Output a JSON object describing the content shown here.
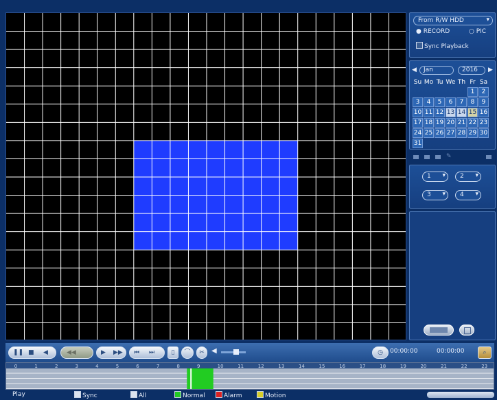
{
  "right_panel": {
    "source_select": "From R/W HDD",
    "mode_record": "RECORD",
    "mode_pic": "PIC",
    "sync_playback": "Sync Playback",
    "month": "Jan",
    "year": "2016",
    "weekdays": [
      "Su",
      "Mo",
      "Tu",
      "We",
      "Th",
      "Fr",
      "Sa"
    ],
    "weeks": [
      [
        "",
        "",
        "",
        "",
        "",
        "1",
        "2"
      ],
      [
        "3",
        "4",
        "5",
        "6",
        "7",
        "8",
        "9"
      ],
      [
        "10",
        "11",
        "12",
        "13",
        "14",
        "15",
        "16"
      ],
      [
        "17",
        "18",
        "19",
        "20",
        "21",
        "22",
        "23"
      ],
      [
        "24",
        "25",
        "26",
        "27",
        "28",
        "29",
        "30"
      ],
      [
        "31",
        "",
        "",
        "",
        "",
        "",
        ""
      ]
    ],
    "channels": [
      "1",
      "2",
      "3",
      "4"
    ]
  },
  "control_bar": {
    "speed_label": "",
    "time_start": "00:00:00",
    "time_end": "00:00:00"
  },
  "timeline": {
    "hours": [
      "0",
      "1",
      "2",
      "3",
      "4",
      "5",
      "6",
      "7",
      "8",
      "9",
      "10",
      "11",
      "12",
      "13",
      "14",
      "15",
      "16",
      "17",
      "18",
      "19",
      "20",
      "21",
      "22",
      "23"
    ]
  },
  "legend": {
    "play": "Play",
    "sync": "Sync",
    "all": "All",
    "normal": "Normal",
    "alarm": "Alarm",
    "motion": "Motion",
    "colors": {
      "normal": "#22cc22",
      "alarm": "#dd2222",
      "motion": "#d8d02a",
      "selection": "#1f3cff"
    }
  }
}
